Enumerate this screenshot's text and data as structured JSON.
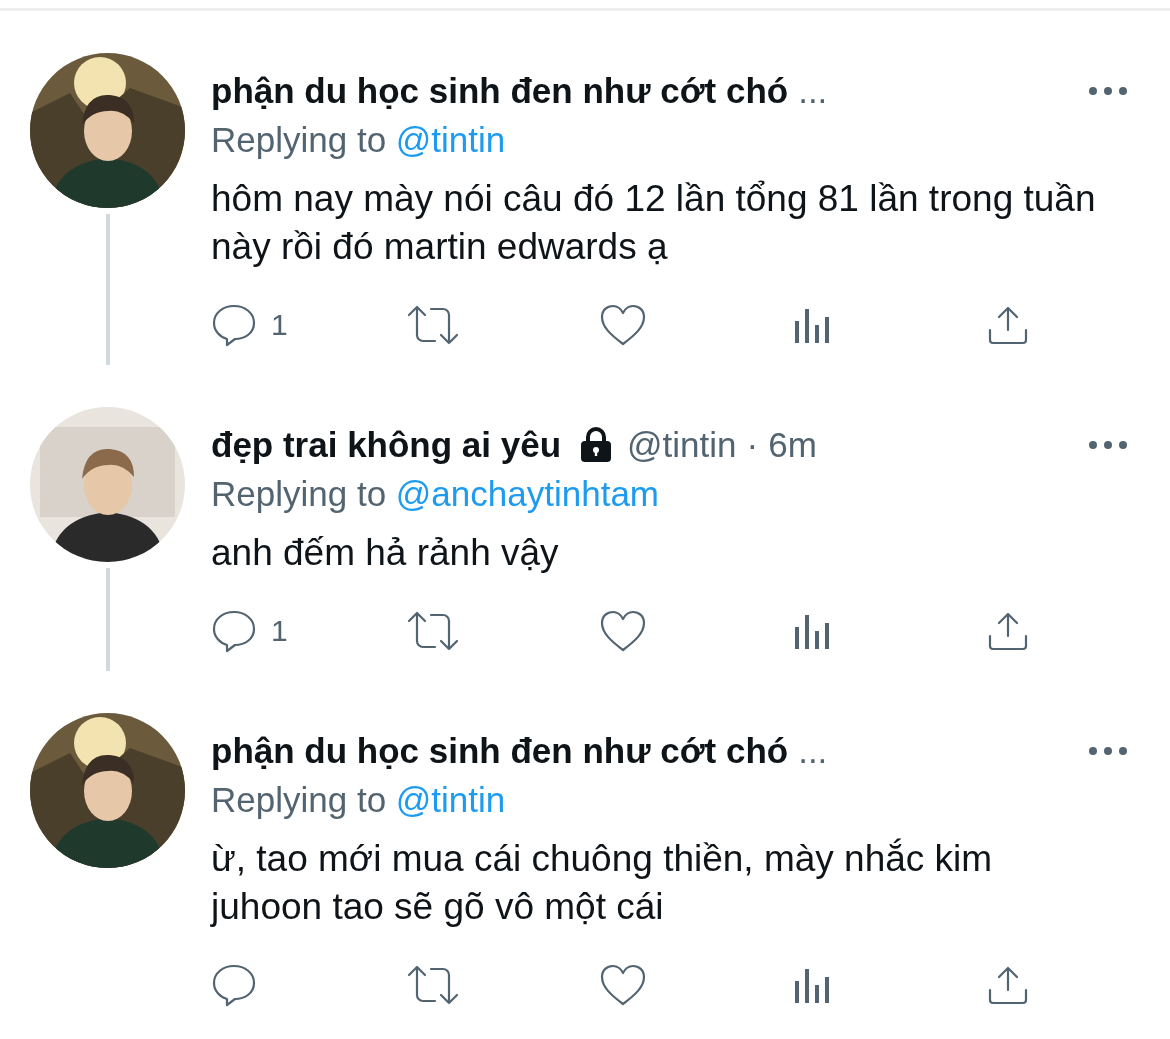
{
  "tweets": [
    {
      "name": "phận du học sinh đen như cớt chó",
      "name_ellipsis": "...",
      "protected": false,
      "reply_label": "Replying to",
      "reply_to": "@tintin",
      "text": "hôm nay mày nói câu đó 12 lần tổng 81 lần trong tuần này rồi đó martin edwards ạ",
      "reply_count": "1",
      "thread_below": true
    },
    {
      "name": "đẹp trai không ai yêu",
      "protected": true,
      "handle": "@tintin",
      "separator": "·",
      "time": "6m",
      "reply_label": "Replying to",
      "reply_to": "@anchaytinhtam",
      "text": "anh đếm hả rảnh vậy",
      "reply_count": "1",
      "thread_below": true
    },
    {
      "name": "phận du học sinh đen như cớt chó",
      "name_ellipsis": "...",
      "protected": false,
      "reply_label": "Replying to",
      "reply_to": "@tintin",
      "text": "ừ, tao mới mua cái chuông thiền, mày nhắc kim juhoon tao sẽ gõ vô một cái",
      "thread_below": false
    }
  ]
}
